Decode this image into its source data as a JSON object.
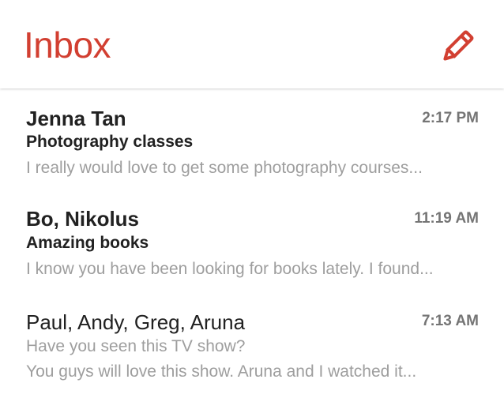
{
  "colors": {
    "accent": "#d23f31",
    "text_primary": "#212121",
    "text_secondary": "#9e9e9e",
    "time": "#757575"
  },
  "header": {
    "title": "Inbox",
    "compose_icon": "pencil-icon"
  },
  "emails": [
    {
      "sender": "Jenna Tan",
      "time": "2:17 PM",
      "subject": "Photography classes",
      "snippet": "I really would love to get some photography courses...",
      "unread": true
    },
    {
      "sender": "Bo, Nikolus",
      "time": "11:19 AM",
      "subject": "Amazing books",
      "snippet": "I know you have been looking for books lately. I found...",
      "unread": true
    },
    {
      "sender": "Paul, Andy, Greg, Aruna",
      "time": "7:13 AM",
      "subject": "Have you seen this TV show?",
      "snippet": "You guys will love this show. Aruna and I watched it...",
      "unread": false
    }
  ]
}
